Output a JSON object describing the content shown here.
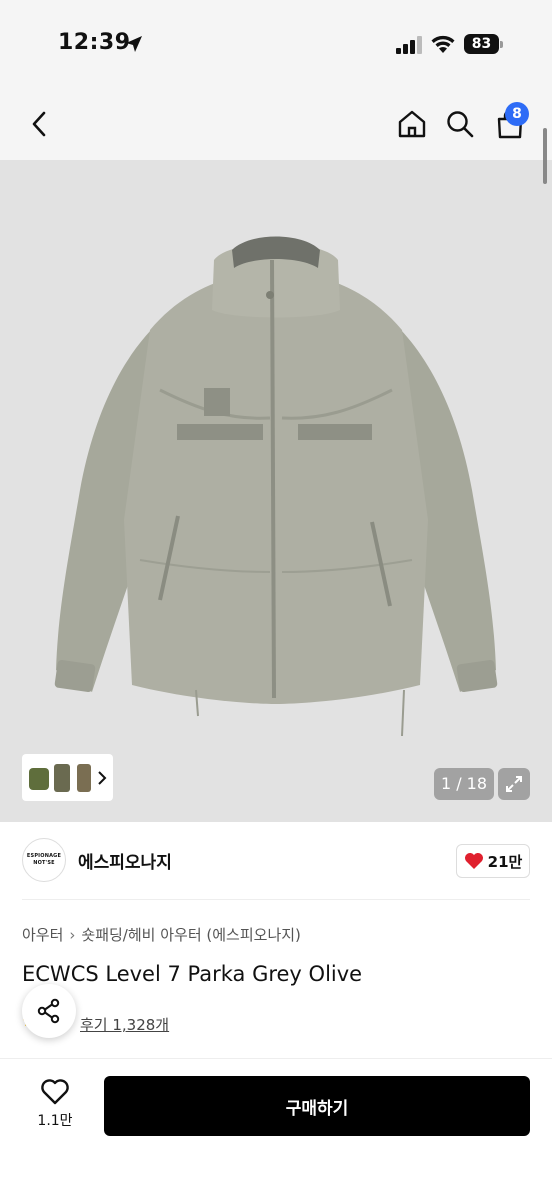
{
  "status_bar": {
    "time": "12:39",
    "battery": "83"
  },
  "header": {
    "cart_count": "8"
  },
  "gallery": {
    "counter": "1 / 18"
  },
  "brand": {
    "logo_line1": "ESPIONAGE",
    "logo_line2": "NOT'SE",
    "name": "에스피오나지",
    "like_count": "21만"
  },
  "product": {
    "breadcrumb": [
      "아우터",
      "숏패딩/헤비 아우터 (에스피오나지)"
    ],
    "title": "ECWCS Level 7 Parka Grey Olive",
    "review_link": "후기 1,328개"
  },
  "bottom_bar": {
    "wish_count": "1.1만",
    "buy_label": "구매하기"
  },
  "colors": {
    "cart_badge": "#2e6cf6",
    "buy_button": "#000000",
    "heart": "#e0202e",
    "jacket": "#a9aa9e",
    "image_bg": "#e2e2e2"
  }
}
